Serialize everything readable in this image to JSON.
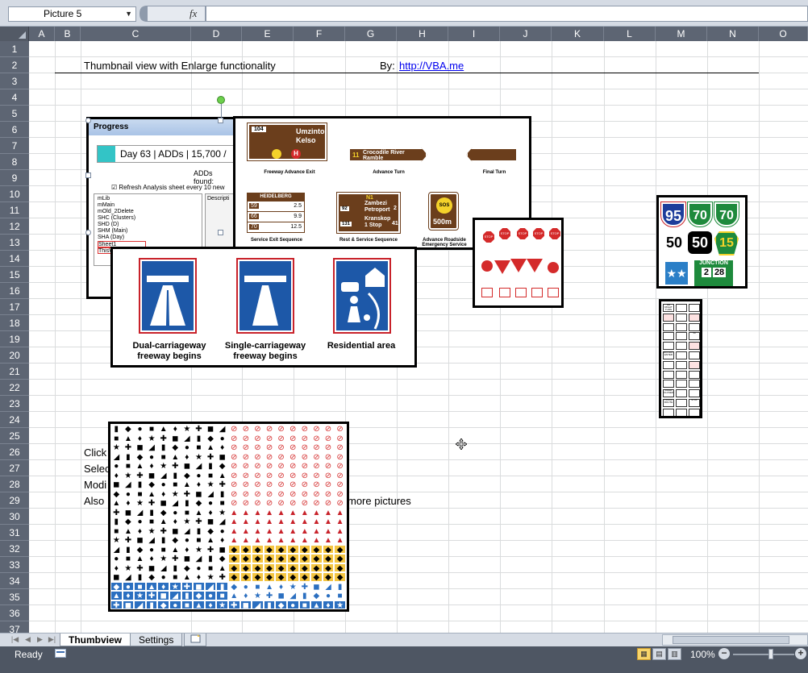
{
  "formula_bar": {
    "name_box": "Picture 5",
    "fx_label": "fx",
    "formula": ""
  },
  "columns": [
    "A",
    "B",
    "C",
    "D",
    "E",
    "F",
    "G",
    "H",
    "I",
    "J",
    "K",
    "L",
    "M",
    "N",
    "O"
  ],
  "rows": [
    "1",
    "2",
    "3",
    "4",
    "5",
    "6",
    "7",
    "8",
    "9",
    "10",
    "11",
    "12",
    "13",
    "14",
    "15",
    "16",
    "17",
    "18",
    "19",
    "20",
    "21",
    "22",
    "23",
    "24",
    "25",
    "26",
    "27",
    "28",
    "29",
    "30",
    "31",
    "32",
    "33",
    "34",
    "35",
    "36",
    "37"
  ],
  "cells": {
    "title": "Thumbnail view with Enlarge functionality",
    "by_label": "By:",
    "by_link": "http://VBA.me",
    "click_text": "Click",
    "select_text": "Selec",
    "modify_text": "Modi",
    "also_text": "Also",
    "more_pictures": "more pictures"
  },
  "progress_picture": {
    "title": "Progress",
    "status": "Day 63 | ADDs | 15,700 /",
    "adds_found": "ADDs found:",
    "refresh": "Refresh Analysis sheet every 10 new",
    "tree_items": [
      "mLib",
      "mMain",
      "mOld_2Delete",
      "SHC (Clusters)",
      "SHD (D)",
      "SHM (Main)",
      "SHA (Day)",
      "Sheet1",
      "ThisWorkbook"
    ],
    "side_header": "Descripti"
  },
  "tourism_picture": {
    "sign_top_number": "104",
    "sign_top_line1": "Umzinto",
    "sign_top_line2": "Kelso",
    "caption_advance_exit": "Freeway Advance Exit",
    "sign_turn_number": "11",
    "sign_turn_text": "Crocodile River Ramble",
    "caption_advance_turn": "Advance Turn",
    "caption_final_turn": "Final Turn",
    "sign_exit_town": "HEIDELBERG",
    "sign_exit_rows": [
      [
        "59",
        "2.5"
      ],
      [
        "66",
        "9.9"
      ],
      [
        "70",
        "12.5"
      ]
    ],
    "caption_service_exit": "Service Exit Sequence",
    "sign_rest_top": "N1",
    "sign_rest_line1": "Zambezi",
    "sign_rest_line2": "Petroport",
    "sign_rest_line3": "Kranskop",
    "sign_rest_line4": "1 Stop",
    "sign_rest_num1": "92",
    "sign_rest_num2": "131",
    "sign_rest_side1": "2",
    "sign_rest_side2": "41",
    "caption_rest_service": "Rest & Service Sequence",
    "sos_label": "SOS",
    "sos_distance": "500m",
    "caption_roadside": "Advance Roadside Emergency Service"
  },
  "freeway_picture": {
    "captions": [
      "Dual-carriageway freeway begins",
      "Single-carriageway freeway begins",
      "Residential area"
    ]
  },
  "stop_picture": {
    "stop_label": "STOP"
  },
  "interstate_picture": {
    "shields": [
      "95",
      "70",
      "70",
      "50",
      "50",
      "15",
      "JUNCTION",
      "2",
      "28"
    ]
  },
  "regulatory_picture": {
    "labels": [
      "NO RIGHT TURN",
      "ONE WAY",
      "DO NOT ENTER",
      "ROAD CLOSED",
      "TRUCK ROUTE",
      "SPEED LIMIT",
      "50",
      "STOP"
    ]
  },
  "tabs": {
    "thumbview": "Thumbview",
    "settings": "Settings"
  },
  "status": {
    "ready": "Ready",
    "zoom": "100%"
  },
  "colors": {
    "header_bg": "#5d6573",
    "sign_brown": "#6b3e1c",
    "sign_blue": "#1d58a8",
    "sign_red": "#d42a2a",
    "shield_green": "#1e8a3c"
  }
}
